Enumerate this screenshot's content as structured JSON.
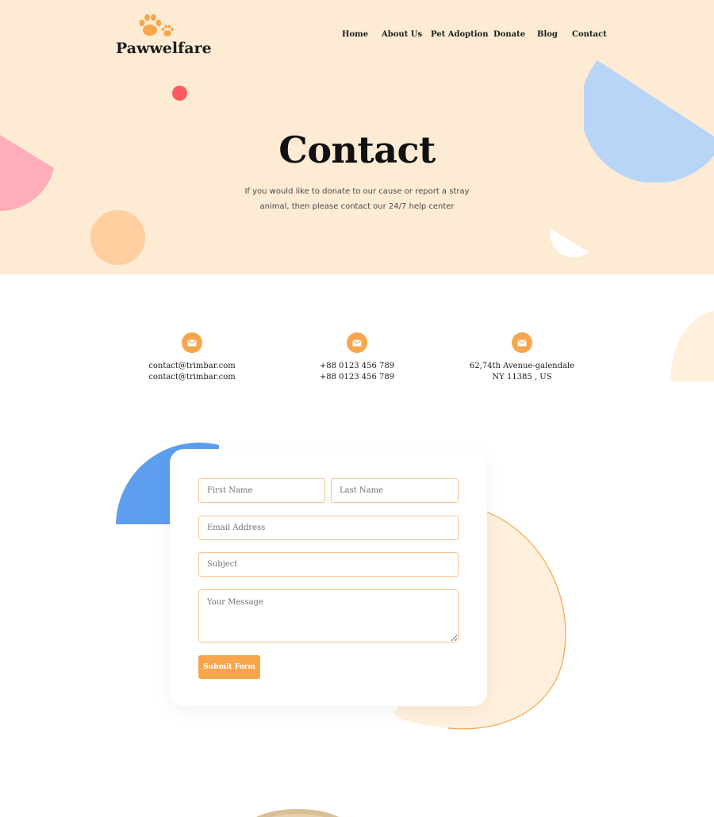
{
  "brand": {
    "name": "Pawwelfare"
  },
  "nav": {
    "items": [
      {
        "label": "Home"
      },
      {
        "label": "About Us"
      },
      {
        "label": "Pet Adoption"
      },
      {
        "label": "Donate"
      },
      {
        "label": "Blog"
      },
      {
        "label": "Contact"
      }
    ]
  },
  "hero": {
    "title": "Contact",
    "subtitle_line1": "If you would like to donate to our cause or report a stray",
    "subtitle_line2": "animal, then please contact our 24/7 help center"
  },
  "contact_info": [
    {
      "icon": "mail-icon",
      "line1": "contact@trimbar.com",
      "line2": "contact@trimbar.com"
    },
    {
      "icon": "mail-icon",
      "line1": "+88 0123 456 789",
      "line2": "+88 0123 456 789"
    },
    {
      "icon": "mail-icon",
      "line1": "62,74th Avenue-galendale",
      "line2": "NY 11385 , US"
    }
  ],
  "form": {
    "first_name_placeholder": "First Name",
    "last_name_placeholder": "Last Name",
    "email_placeholder": "Email Address",
    "subject_placeholder": "Subject",
    "message_placeholder": "Your Message",
    "submit_label": "Submit Form"
  },
  "colors": {
    "hero_bg": "#fdebd3",
    "accent_orange": "#f7a64c",
    "field_border": "#f6c58c",
    "blue_shape": "#5d9eee",
    "light_blue_shape": "#b8d4f7",
    "pink_shape": "#ffadb9",
    "red_dot": "#ff5a5f",
    "peach_circle": "#ffcfa0",
    "cream_blob": "#fef0dc"
  }
}
